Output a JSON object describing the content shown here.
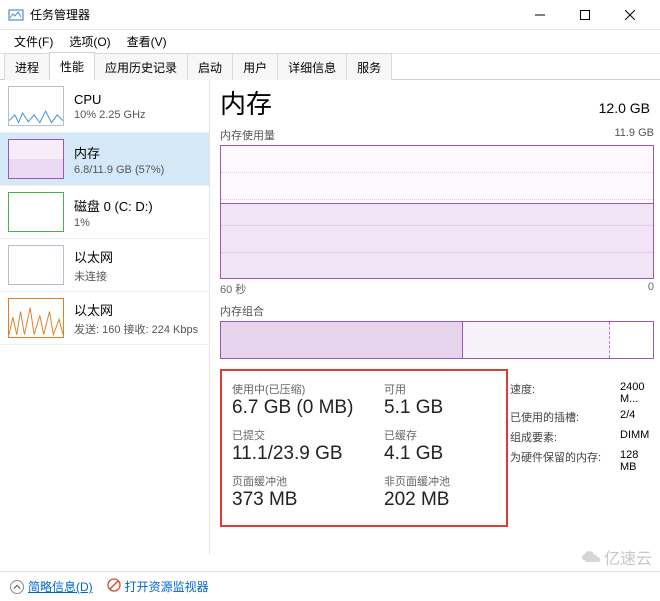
{
  "window": {
    "title": "任务管理器",
    "controls": {
      "minimize": "minimize",
      "maximize": "maximize",
      "close": "close"
    }
  },
  "menu": {
    "file": "文件(F)",
    "options": "选项(O)",
    "view": "查看(V)"
  },
  "tabs": {
    "processes": "进程",
    "performance": "性能",
    "app_history": "应用历史记录",
    "startup": "启动",
    "users": "用户",
    "details": "详细信息",
    "services": "服务"
  },
  "sidebar": {
    "cpu": {
      "title": "CPU",
      "sub": "10% 2.25 GHz"
    },
    "memory": {
      "title": "内存",
      "sub": "6.8/11.9 GB (57%)"
    },
    "disk": {
      "title": "磁盘 0 (C: D:)",
      "sub": "1%"
    },
    "eth1": {
      "title": "以太网",
      "sub": "未连接"
    },
    "eth2": {
      "title": "以太网",
      "sub": "发送: 160 接收: 224 Kbps"
    }
  },
  "main": {
    "title": "内存",
    "total": "12.0 GB",
    "usage_label": "内存使用量",
    "usage_max": "11.9 GB",
    "x_left": "60 秒",
    "x_right": "0",
    "comp_label": "内存组合",
    "metrics": {
      "in_use_label": "使用中(已压缩)",
      "in_use_value": "6.7 GB (0 MB)",
      "available_label": "可用",
      "available_value": "5.1 GB",
      "committed_label": "已提交",
      "committed_value": "11.1/23.9 GB",
      "cached_label": "已缓存",
      "cached_value": "4.1 GB",
      "paged_label": "页面缓冲池",
      "paged_value": "373 MB",
      "nonpaged_label": "非页面缓冲池",
      "nonpaged_value": "202 MB"
    },
    "specs": {
      "speed_k": "速度:",
      "speed_v": "2400 M...",
      "slots_k": "已使用的插槽:",
      "slots_v": "2/4",
      "form_k": "组成要素:",
      "form_v": "DIMM",
      "reserved_k": "为硬件保留的内存:",
      "reserved_v": "128 MB"
    }
  },
  "footer": {
    "fewer": "简略信息(D)",
    "resmon": "打开资源监视器"
  },
  "watermark": "亿速云",
  "chart_data": {
    "type": "area",
    "title": "内存使用量",
    "xlabel": "60 秒",
    "ylabel": "GB",
    "ylim": [
      0,
      11.9
    ],
    "x": [
      60,
      50,
      40,
      30,
      20,
      10,
      0
    ],
    "series": [
      {
        "name": "内存使用量",
        "values": [
          6.8,
          6.8,
          6.8,
          6.8,
          6.8,
          6.8,
          6.8
        ]
      }
    ],
    "composition": {
      "type": "bar",
      "categories": [
        "使用中",
        "已缓存",
        "可用"
      ],
      "values": [
        6.7,
        4.1,
        1.1
      ],
      "total": 11.9
    }
  }
}
